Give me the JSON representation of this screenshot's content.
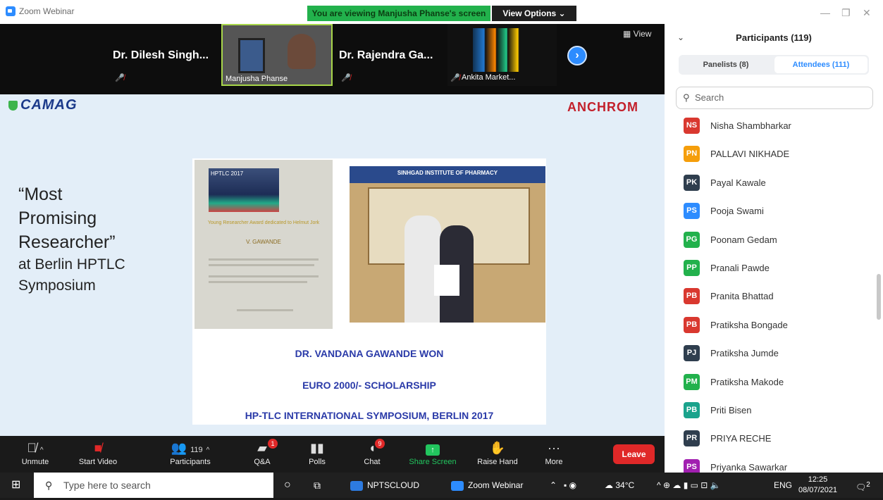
{
  "titlebar": {
    "app_title": "Zoom Webinar",
    "viewing_banner": "You are viewing Manjusha Phanse's screen",
    "view_options": "View Options ⌄"
  },
  "strip": {
    "tiles": [
      {
        "name": "Dr. Dilesh Singh..."
      },
      {
        "name": "Manjusha Phanse"
      },
      {
        "name": "Dr. Rajendra Ga..."
      },
      {
        "name": "Ankita Market..."
      }
    ],
    "view_label": "View"
  },
  "slide": {
    "logo_left": "CAMAG",
    "logo_right": "ANCHROM",
    "left_lines": [
      "“Most",
      "Promising",
      "Researcher”",
      "at Berlin HPTLC",
      "Symposium"
    ],
    "cert_header": "HPTLC 2017",
    "cert_award": "Young Researcher Award dedicated to Helmut Jork",
    "cert_name": "V. GAWANDE",
    "photo_banner": "SINHGAD INSTITUTE OF PHARMACY",
    "captions": [
      "DR. VANDANA GAWANDE WON",
      "EURO 2000/-  SCHOLARSHIP",
      "HP-TLC INTERNATIONAL SYMPOSIUM, BERLIN 2017"
    ]
  },
  "toolbar": {
    "unmute": "Unmute",
    "start_video": "Start Video",
    "participants": "Participants",
    "participants_count": "119",
    "qa": "Q&A",
    "qa_badge": "1",
    "polls": "Polls",
    "chat": "Chat",
    "chat_badge": "9",
    "share_screen": "Share Screen",
    "raise_hand": "Raise Hand",
    "more": "More",
    "leave": "Leave"
  },
  "panel": {
    "title": "Participants (119)",
    "tab_panelists": "Panelists (8)",
    "tab_attendees": "Attendees (111)",
    "search_placeholder": "Search",
    "participants": [
      {
        "initials": "NS",
        "name": "Nisha Shambharkar",
        "color": "#d9382f"
      },
      {
        "initials": "PN",
        "name": "PALLAVI NIKHADE",
        "color": "#f59e0b"
      },
      {
        "initials": "PK",
        "name": "Payal Kawale",
        "color": "#2f3e4e"
      },
      {
        "initials": "PS",
        "name": "Pooja Swami",
        "color": "#2d8cff"
      },
      {
        "initials": "PG",
        "name": "Poonam Gedam",
        "color": "#22b14c"
      },
      {
        "initials": "PP",
        "name": "Pranali Pawde",
        "color": "#22b14c"
      },
      {
        "initials": "PB",
        "name": "Pranita Bhattad",
        "color": "#d9382f"
      },
      {
        "initials": "PB",
        "name": "Pratiksha Bongade",
        "color": "#d9382f"
      },
      {
        "initials": "PJ",
        "name": "Pratiksha Jumde",
        "color": "#2f3e4e"
      },
      {
        "initials": "PM",
        "name": "Pratiksha Makode",
        "color": "#22b14c"
      },
      {
        "initials": "PB",
        "name": "Priti Bisen",
        "color": "#1aa38c"
      },
      {
        "initials": "PR",
        "name": "PRIYA RECHE",
        "color": "#2f3e4e"
      },
      {
        "initials": "PS",
        "name": "Priyanka Sawarkar",
        "color": "#a11fb0"
      }
    ]
  },
  "taskbar": {
    "search_placeholder": "Type here to search",
    "app1": "NPTSCLOUD",
    "app2": "Zoom Webinar",
    "temperature": "34°C",
    "language": "ENG",
    "time": "12:25",
    "date": "08/07/2021",
    "notification_count": "2"
  }
}
